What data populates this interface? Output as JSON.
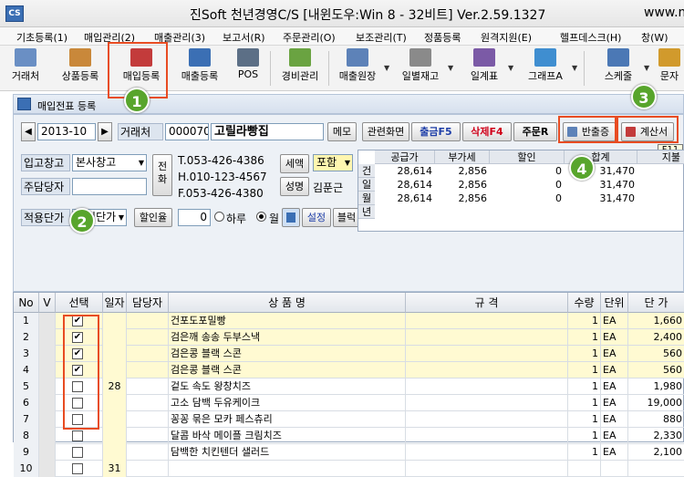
{
  "window": {
    "icon_label": "CS",
    "title": "진Soft 천년경영C/S [내윈도우:Win 8 - 32비트] Ver.2.59.1327",
    "title_trail": "www.m"
  },
  "menu": [
    "기초등록(1)",
    "매입관리(2)",
    "매출관리(3)",
    "보고서(R)",
    "주문관리(O)",
    "보조관리(T)",
    "정품등록",
    "원격지원(E)",
    "헬프데스크(H)",
    "창(W)"
  ],
  "toolbar": [
    {
      "label": "거래처",
      "icon": "client-icon",
      "color": "#6a8fc4"
    },
    {
      "label": "상품등록",
      "icon": "product-box-icon",
      "color": "#c9883a"
    },
    {
      "label": "매입등록",
      "icon": "purchase-entry-icon",
      "color": "#c33b3b"
    },
    {
      "label": "매출등록",
      "icon": "sales-entry-icon",
      "color": "#3b6fb4"
    },
    {
      "label": "POS",
      "icon": "pos-icon",
      "color": "#5c6f86"
    },
    {
      "label": "경비관리",
      "icon": "expense-icon",
      "color": "#6aa341"
    },
    {
      "label": "매출원장",
      "icon": "sales-ledger-icon",
      "color": "#5d82b8"
    },
    {
      "label": "일별재고",
      "icon": "daily-stock-icon",
      "color": "#8a8a8a"
    },
    {
      "label": "일계표",
      "icon": "daily-report-icon",
      "color": "#7b5aa6"
    },
    {
      "label": "그래프A",
      "icon": "graph-icon",
      "color": "#3f8ed0"
    },
    {
      "label": "스케줄",
      "icon": "schedule-icon",
      "color": "#4b78b5"
    },
    {
      "label": "문자",
      "icon": "message-icon",
      "color": "#d19a2c"
    }
  ],
  "inner_window": {
    "icon_label": "CS",
    "title": "매입전표 등록"
  },
  "form": {
    "date": "2013-10",
    "client_label": "거래처",
    "client_code": "000070",
    "client_name": "고릴라빵집",
    "memo_button": "메모",
    "warehouse_label": "입고창고",
    "warehouse_value": "본사창고",
    "manager_label": "주담당자",
    "manager_value": "",
    "phone_button": "전화",
    "phone": "T.053-426-4386",
    "mobile": "H.010-123-4567",
    "fax": "F.053-426-4380",
    "tax_button": "세액",
    "tax_mode": "포함",
    "name_button": "성명",
    "person_name": "김푼근",
    "price_label": "적용단가",
    "price_value": "매입단가",
    "discount_button": "할인율",
    "discount_value": "0",
    "radio_below": "하루",
    "radio_month": "월",
    "settings_button": "설정",
    "block_button": "블럭"
  },
  "actions": {
    "related": "관련화면",
    "payment": "출금F5",
    "delete": "삭제F4",
    "order": "주문R",
    "return": "반출증",
    "invoice": "계산서",
    "f11_tooltip": "F11"
  },
  "summary": {
    "headers": [
      "공급가",
      "부가세",
      "할인",
      "합계",
      "지불"
    ],
    "side": [
      "건",
      "일",
      "월",
      "년"
    ],
    "rows": [
      [
        "28,614",
        "2,856",
        "0",
        "31,470"
      ],
      [
        "28,614",
        "2,856",
        "0",
        "31,470"
      ],
      [
        "28,614",
        "2,856",
        "0",
        "31,470"
      ]
    ]
  },
  "grid": {
    "headers": [
      "No",
      "V",
      "선택",
      "일자",
      "담당자",
      "상 품 명",
      "규 격",
      "수량",
      "단위",
      "단 가"
    ],
    "rows": [
      {
        "no": "1",
        "checked": true,
        "date": "",
        "name": "건포도포밀빵",
        "spec": "",
        "qty": "1",
        "unit": "EA",
        "price": "1,660"
      },
      {
        "no": "2",
        "checked": true,
        "date": "",
        "name": "검은깨 송송 두부스낵",
        "spec": "",
        "qty": "1",
        "unit": "EA",
        "price": "2,400"
      },
      {
        "no": "3",
        "checked": true,
        "date": "",
        "name": "검은콩 블랙 스콘",
        "spec": "",
        "qty": "1",
        "unit": "EA",
        "price": "560"
      },
      {
        "no": "4",
        "checked": true,
        "date": "",
        "name": "검은콩 블랙 스콘",
        "spec": "",
        "qty": "1",
        "unit": "EA",
        "price": "560"
      },
      {
        "no": "5",
        "checked": false,
        "date": "28",
        "name": "겉도 속도 왕창치즈",
        "spec": "",
        "qty": "1",
        "unit": "EA",
        "price": "1,980"
      },
      {
        "no": "6",
        "checked": false,
        "date": "",
        "name": "고소 담백 두유케이크",
        "spec": "",
        "qty": "1",
        "unit": "EA",
        "price": "19,000"
      },
      {
        "no": "7",
        "checked": false,
        "date": "",
        "name": "꽁꽁 묶은 모카 페스츄리",
        "spec": "",
        "qty": "1",
        "unit": "EA",
        "price": "880"
      },
      {
        "no": "8",
        "checked": false,
        "date": "",
        "name": "달콤 바삭 메이플 크림치즈",
        "spec": "",
        "qty": "1",
        "unit": "EA",
        "price": "2,330"
      },
      {
        "no": "9",
        "checked": false,
        "date": "",
        "name": "담백한 치킨텐더 샐러드",
        "spec": "",
        "qty": "1",
        "unit": "EA",
        "price": "2,100"
      },
      {
        "no": "10",
        "checked": false,
        "date": "31",
        "name": "",
        "spec": "",
        "qty": "",
        "unit": "",
        "price": ""
      }
    ]
  },
  "annotations": [
    "1",
    "2",
    "3",
    "4"
  ],
  "colors": {
    "highlight": "#e84c22",
    "badge": "#58a52c",
    "row_yellow": "#fffad2",
    "delete_red": "#d0021b",
    "payment_blue": "#1f3fa8"
  }
}
